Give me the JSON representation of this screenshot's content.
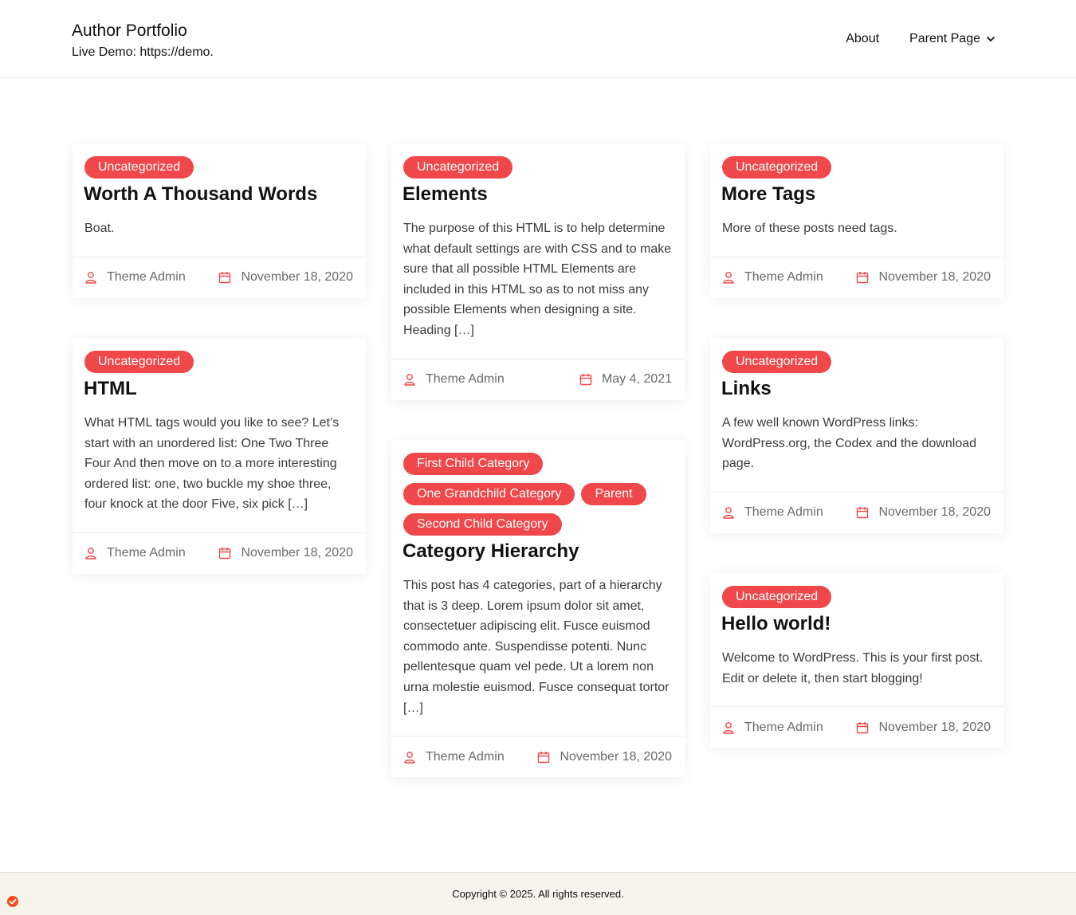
{
  "header": {
    "site_title": "Author Portfolio",
    "site_description": "Live Demo: https://demo.",
    "nav": [
      {
        "label": "About"
      },
      {
        "label": "Parent Page",
        "has_dropdown": true
      }
    ]
  },
  "theme": {
    "accent": "#f0474a",
    "meta_icon_color": "#f0474a",
    "footer_bg": "#f7f4ec"
  },
  "posts": [
    {
      "categories": [
        "Uncategorized"
      ],
      "title": "Worth A Thousand Words",
      "excerpt": "Boat.",
      "author": "Theme Admin",
      "date": "November 18, 2020"
    },
    {
      "categories": [
        "Uncategorized"
      ],
      "title": "Elements",
      "excerpt": "The purpose of this HTML is to help determine what default settings are with CSS and to make sure that all possible HTML Elements are included in this HTML so as to not miss any possible Elements when designing a site. Heading […]",
      "author": "Theme Admin",
      "date": "May 4, 2021"
    },
    {
      "categories": [
        "Uncategorized"
      ],
      "title": "More Tags",
      "excerpt": "More of these posts need tags.",
      "author": "Theme Admin",
      "date": "November 18, 2020"
    },
    {
      "categories": [
        "Uncategorized"
      ],
      "title": "HTML",
      "excerpt": "What HTML tags would you like to see? Let’s start with an unordered list: One Two Three Four And then move on to a more interesting ordered list: one, two buckle my shoe three, four knock at the door Five, six pick […]",
      "author": "Theme Admin",
      "date": "November 18, 2020"
    },
    {
      "categories": [
        "First Child Category",
        "One Grandchild Category",
        "Parent",
        "Second Child Category"
      ],
      "title": "Category Hierarchy",
      "excerpt": "This post has 4 categories, part of a hierarchy that is 3 deep. Lorem ipsum dolor sit amet, consectetuer adipiscing elit. Fusce euismod commodo ante. Suspendisse potenti. Nunc pellentesque quam vel pede. Ut a lorem non urna molestie euismod. Fusce consequat tortor […]",
      "author": "Theme Admin",
      "date": "November 18, 2020"
    },
    {
      "categories": [
        "Uncategorized"
      ],
      "title": "Links",
      "excerpt": "A few well known WordPress links: WordPress.org, the Codex and the download page.",
      "author": "Theme Admin",
      "date": "November 18, 2020"
    },
    {
      "categories": [
        "Uncategorized"
      ],
      "title": "Hello world!",
      "excerpt": "Welcome to WordPress. This is your first post. Edit or delete it, then start blogging!",
      "author": "Theme Admin",
      "date": "November 18, 2020"
    }
  ],
  "footer": {
    "copyright": "Copyright © 2025. All rights reserved."
  }
}
